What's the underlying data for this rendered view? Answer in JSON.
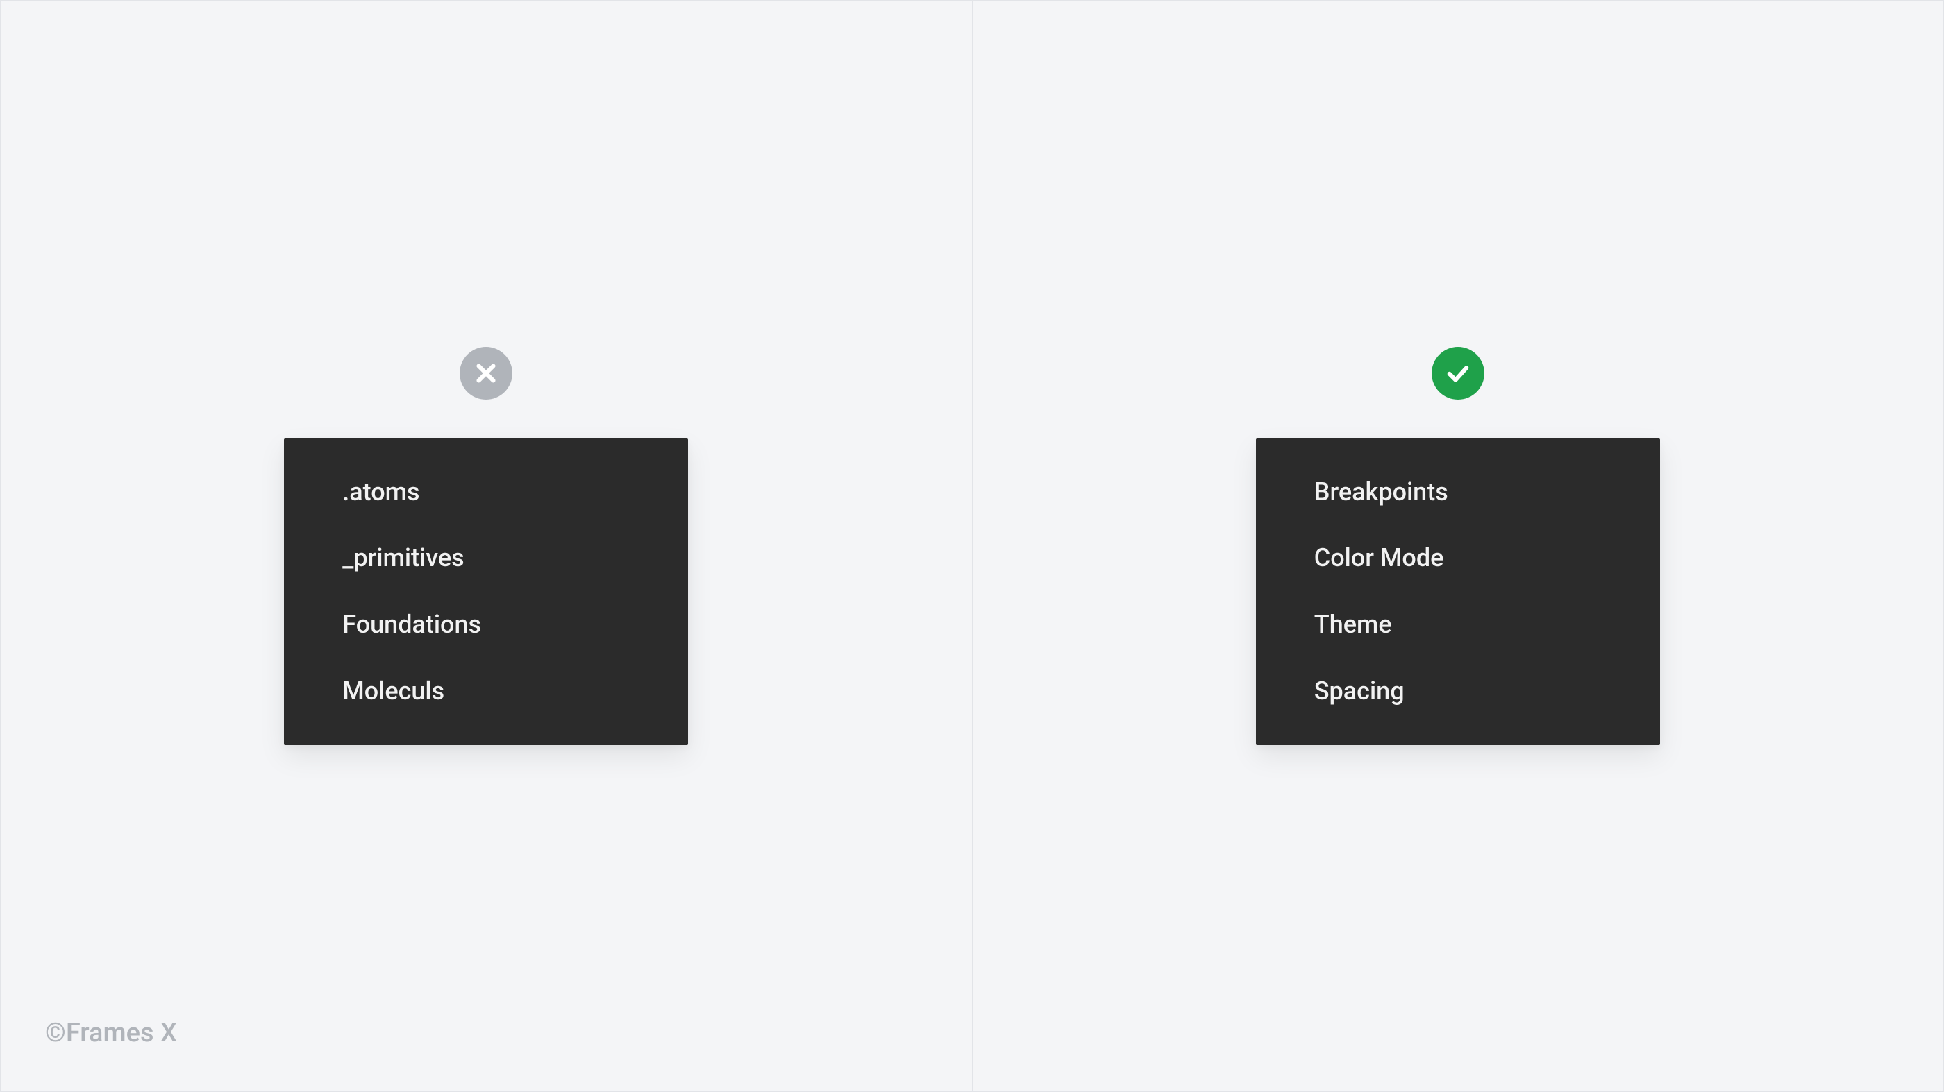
{
  "left_panel": {
    "status": "wrong",
    "items": [
      ".atoms",
      "_primitives",
      "Foundations",
      "Moleculs"
    ]
  },
  "right_panel": {
    "status": "correct",
    "items": [
      "Breakpoints",
      "Color Mode",
      "Theme",
      "Spacing"
    ]
  },
  "copyright": "©Frames X"
}
